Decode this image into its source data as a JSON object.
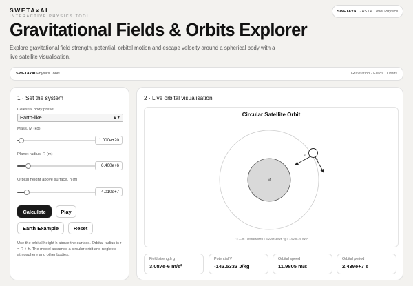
{
  "header": {
    "brand": "SWETAxAI",
    "kicker": "INTERACTIVE PHYSICS TOOL",
    "badge_brand": "SWETAxAI",
    "badge_sub": "· AS / A Level Physics",
    "title": "Gravitational Fields & Orbits Explorer",
    "description": "Explore gravitational field strength, potential, orbital motion and escape velocity around a spherical body with a live satellite visualisation."
  },
  "toolbar": {
    "brand": "SWETAxAI",
    "label": "Physics Tools",
    "breadcrumb": "Gravitation · Fields · Orbits"
  },
  "setup": {
    "heading": "1 · Set the system",
    "preset_label": "Celestial body preset",
    "preset_value": "Earth-like",
    "mass": {
      "label": "Mass, M (kg)",
      "value": "1.000e+20",
      "level": 0.05
    },
    "radius": {
      "label": "Planet radius, R (m)",
      "value": "6.400e+6",
      "level": 0.14
    },
    "height": {
      "label": "Orbital height above surface, h (m)",
      "value": "4.010e+7",
      "level": 0.12
    },
    "buttons": {
      "calculate": "Calculate",
      "play": "Play",
      "earth": "Earth Example",
      "reset": "Reset"
    },
    "note": "Use the orbital height h above the surface. Orbital radius is r = R + h. The model assumes a circular orbit and neglects atmosphere and other bodies."
  },
  "visual": {
    "heading": "2 · Live orbital visualisation",
    "canvas_title": "Circular Satellite Orbit",
    "planet_label": "M",
    "g_label": "g",
    "v_label": "v",
    "footer": "r = — m · orbital speed = 3.229e-3 m/s · g = 1.629e-20 m/s²",
    "colors": {
      "planet": "#d9d9d9",
      "orbit": "#cccccc",
      "satellite": "#ffffff"
    }
  },
  "results": [
    {
      "label": "Field strength g",
      "value": "3.087e-6 m/s²"
    },
    {
      "label": "Potential V",
      "value": "-143.5333 J/kg"
    },
    {
      "label": "Orbital speed",
      "value": "11.9805 m/s"
    },
    {
      "label": "Orbital period",
      "value": "2.439e+7 s"
    }
  ]
}
